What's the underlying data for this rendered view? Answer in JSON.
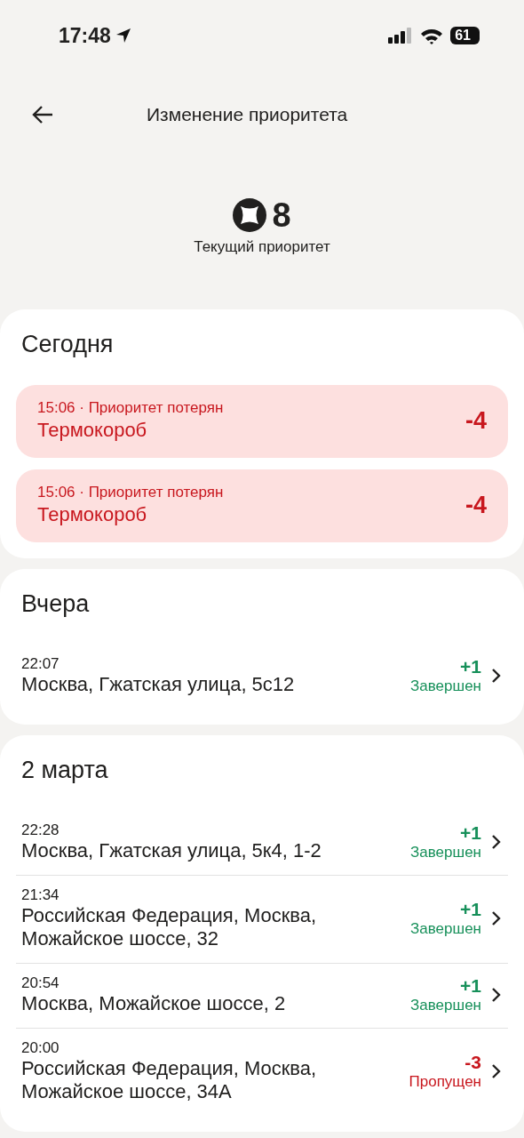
{
  "status_bar": {
    "time": "17:48",
    "battery": "61"
  },
  "header": {
    "title": "Изменение приоритета"
  },
  "priority": {
    "value": "8",
    "label": "Текущий приоритет"
  },
  "sections": [
    {
      "title": "Сегодня",
      "items": [
        {
          "kind": "lost",
          "note": "15:06 · Приоритет потерян",
          "title": "Термокороб",
          "delta": "-4"
        },
        {
          "kind": "lost",
          "note": "15:06 · Приоритет потерян",
          "title": "Термокороб",
          "delta": "-4"
        }
      ]
    },
    {
      "title": "Вчера",
      "items": [
        {
          "kind": "done",
          "time": "22:07",
          "title": "Москва, Гжатская улица, 5с12",
          "delta": "+1",
          "status": "Завершен"
        }
      ]
    },
    {
      "title": "2 марта",
      "items": [
        {
          "kind": "done",
          "time": "22:28",
          "title": "Москва, Гжатская улица, 5к4, 1-2",
          "delta": "+1",
          "status": "Завершен"
        },
        {
          "kind": "done",
          "time": "21:34",
          "title": "Российская Федерация, Москва, Можайское шоссе, 32",
          "delta": "+1",
          "status": "Завершен"
        },
        {
          "kind": "done",
          "time": "20:54",
          "title": "Москва, Можайское шоссе, 2",
          "delta": "+1",
          "status": "Завершен"
        },
        {
          "kind": "skipped",
          "time": "20:00",
          "title": "Российская Федерация, Москва, Можайское шоссе, 34А",
          "delta": "-3",
          "status": "Пропущен"
        }
      ]
    }
  ]
}
